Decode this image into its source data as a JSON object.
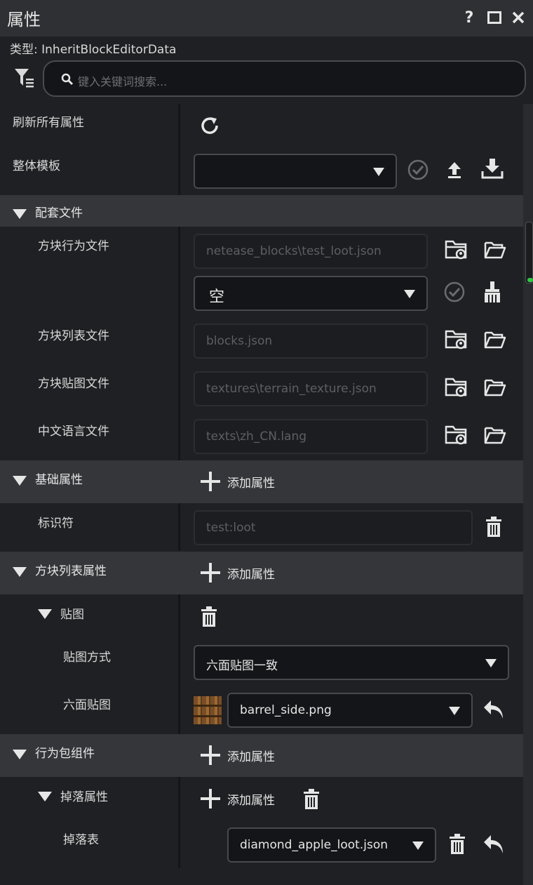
{
  "window": {
    "title": "属性",
    "help": "?",
    "maximize": "□",
    "close": "✕"
  },
  "type_line": "类型: InheritBlockEditorData",
  "search": {
    "placeholder": "键入关键词搜索..."
  },
  "rows": {
    "refresh_all": "刷新所有属性",
    "whole_template": "整体模板"
  },
  "sections": {
    "companion_files": {
      "label": "配套文件",
      "block_behavior_label": "方块行为文件",
      "block_behavior_value": "netease_blocks\\test_loot.json",
      "empty_select": "空",
      "block_list_label": "方块列表文件",
      "block_list_value": "blocks.json",
      "block_texture_label": "方块贴图文件",
      "block_texture_value": "textures\\terrain_texture.json",
      "zh_lang_label": "中文语言文件",
      "zh_lang_value": "texts\\zh_CN.lang"
    },
    "basic": {
      "label": "基础属性",
      "add": "添加属性",
      "identifier_label": "标识符",
      "identifier_value": "test:loot"
    },
    "block_list": {
      "label": "方块列表属性",
      "add": "添加属性",
      "texture_group": "贴图",
      "texture_mode_label": "贴图方式",
      "texture_mode_value": "六面贴图一致",
      "six_face_label": "六面贴图",
      "six_face_value": "barrel_side.png"
    },
    "behavior_components": {
      "label": "行为包组件",
      "add": "添加属性",
      "loot_group": "掉落属性",
      "loot_add": "添加属性",
      "loot_table_label": "掉落表",
      "loot_table_value": "diamond_apple_loot.json"
    }
  },
  "colors": {
    "background": "#1f2023",
    "section": "#35363a",
    "titlebar": "#2f3033",
    "accent": "#2ecc40"
  }
}
